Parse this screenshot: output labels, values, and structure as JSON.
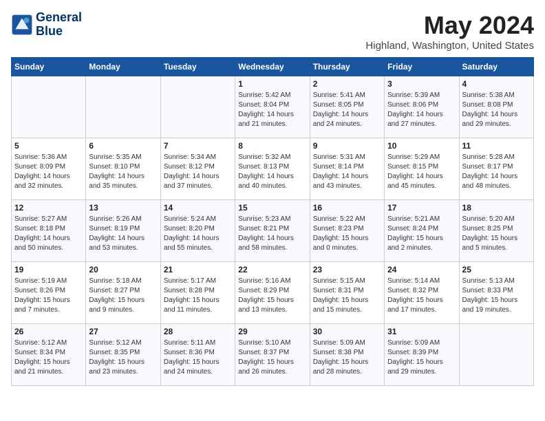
{
  "header": {
    "logo_line1": "General",
    "logo_line2": "Blue",
    "month": "May 2024",
    "location": "Highland, Washington, United States"
  },
  "weekdays": [
    "Sunday",
    "Monday",
    "Tuesday",
    "Wednesday",
    "Thursday",
    "Friday",
    "Saturday"
  ],
  "weeks": [
    [
      {
        "day": "",
        "info": ""
      },
      {
        "day": "",
        "info": ""
      },
      {
        "day": "",
        "info": ""
      },
      {
        "day": "1",
        "info": "Sunrise: 5:42 AM\nSunset: 8:04 PM\nDaylight: 14 hours\nand 21 minutes."
      },
      {
        "day": "2",
        "info": "Sunrise: 5:41 AM\nSunset: 8:05 PM\nDaylight: 14 hours\nand 24 minutes."
      },
      {
        "day": "3",
        "info": "Sunrise: 5:39 AM\nSunset: 8:06 PM\nDaylight: 14 hours\nand 27 minutes."
      },
      {
        "day": "4",
        "info": "Sunrise: 5:38 AM\nSunset: 8:08 PM\nDaylight: 14 hours\nand 29 minutes."
      }
    ],
    [
      {
        "day": "5",
        "info": "Sunrise: 5:36 AM\nSunset: 8:09 PM\nDaylight: 14 hours\nand 32 minutes."
      },
      {
        "day": "6",
        "info": "Sunrise: 5:35 AM\nSunset: 8:10 PM\nDaylight: 14 hours\nand 35 minutes."
      },
      {
        "day": "7",
        "info": "Sunrise: 5:34 AM\nSunset: 8:12 PM\nDaylight: 14 hours\nand 37 minutes."
      },
      {
        "day": "8",
        "info": "Sunrise: 5:32 AM\nSunset: 8:13 PM\nDaylight: 14 hours\nand 40 minutes."
      },
      {
        "day": "9",
        "info": "Sunrise: 5:31 AM\nSunset: 8:14 PM\nDaylight: 14 hours\nand 43 minutes."
      },
      {
        "day": "10",
        "info": "Sunrise: 5:29 AM\nSunset: 8:15 PM\nDaylight: 14 hours\nand 45 minutes."
      },
      {
        "day": "11",
        "info": "Sunrise: 5:28 AM\nSunset: 8:17 PM\nDaylight: 14 hours\nand 48 minutes."
      }
    ],
    [
      {
        "day": "12",
        "info": "Sunrise: 5:27 AM\nSunset: 8:18 PM\nDaylight: 14 hours\nand 50 minutes."
      },
      {
        "day": "13",
        "info": "Sunrise: 5:26 AM\nSunset: 8:19 PM\nDaylight: 14 hours\nand 53 minutes."
      },
      {
        "day": "14",
        "info": "Sunrise: 5:24 AM\nSunset: 8:20 PM\nDaylight: 14 hours\nand 55 minutes."
      },
      {
        "day": "15",
        "info": "Sunrise: 5:23 AM\nSunset: 8:21 PM\nDaylight: 14 hours\nand 58 minutes."
      },
      {
        "day": "16",
        "info": "Sunrise: 5:22 AM\nSunset: 8:23 PM\nDaylight: 15 hours\nand 0 minutes."
      },
      {
        "day": "17",
        "info": "Sunrise: 5:21 AM\nSunset: 8:24 PM\nDaylight: 15 hours\nand 2 minutes."
      },
      {
        "day": "18",
        "info": "Sunrise: 5:20 AM\nSunset: 8:25 PM\nDaylight: 15 hours\nand 5 minutes."
      }
    ],
    [
      {
        "day": "19",
        "info": "Sunrise: 5:19 AM\nSunset: 8:26 PM\nDaylight: 15 hours\nand 7 minutes."
      },
      {
        "day": "20",
        "info": "Sunrise: 5:18 AM\nSunset: 8:27 PM\nDaylight: 15 hours\nand 9 minutes."
      },
      {
        "day": "21",
        "info": "Sunrise: 5:17 AM\nSunset: 8:28 PM\nDaylight: 15 hours\nand 11 minutes."
      },
      {
        "day": "22",
        "info": "Sunrise: 5:16 AM\nSunset: 8:29 PM\nDaylight: 15 hours\nand 13 minutes."
      },
      {
        "day": "23",
        "info": "Sunrise: 5:15 AM\nSunset: 8:31 PM\nDaylight: 15 hours\nand 15 minutes."
      },
      {
        "day": "24",
        "info": "Sunrise: 5:14 AM\nSunset: 8:32 PM\nDaylight: 15 hours\nand 17 minutes."
      },
      {
        "day": "25",
        "info": "Sunrise: 5:13 AM\nSunset: 8:33 PM\nDaylight: 15 hours\nand 19 minutes."
      }
    ],
    [
      {
        "day": "26",
        "info": "Sunrise: 5:12 AM\nSunset: 8:34 PM\nDaylight: 15 hours\nand 21 minutes."
      },
      {
        "day": "27",
        "info": "Sunrise: 5:12 AM\nSunset: 8:35 PM\nDaylight: 15 hours\nand 23 minutes."
      },
      {
        "day": "28",
        "info": "Sunrise: 5:11 AM\nSunset: 8:36 PM\nDaylight: 15 hours\nand 24 minutes."
      },
      {
        "day": "29",
        "info": "Sunrise: 5:10 AM\nSunset: 8:37 PM\nDaylight: 15 hours\nand 26 minutes."
      },
      {
        "day": "30",
        "info": "Sunrise: 5:09 AM\nSunset: 8:38 PM\nDaylight: 15 hours\nand 28 minutes."
      },
      {
        "day": "31",
        "info": "Sunrise: 5:09 AM\nSunset: 8:39 PM\nDaylight: 15 hours\nand 29 minutes."
      },
      {
        "day": "",
        "info": ""
      }
    ]
  ]
}
